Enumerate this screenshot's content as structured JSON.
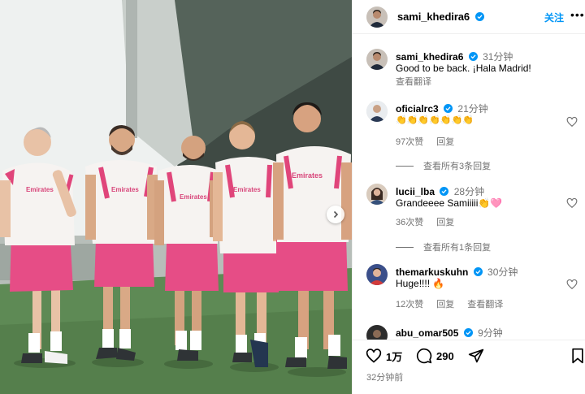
{
  "colors": {
    "accent": "#0095f6",
    "secondary_text": "#737373",
    "jersey_pink": "#e0457a",
    "shorts_pink": "#e64d86",
    "pitch_green": "#5e8a55"
  },
  "photo": {
    "jersey_sponsor": "Emirates"
  },
  "header": {
    "username": "sami_khedira6",
    "follow_label": "关注",
    "more_label": "•••"
  },
  "caption": {
    "username": "sami_khedira6",
    "time": "31分钟",
    "text": "Good to be back. ¡Hala Madrid!",
    "translate_label": "查看翻译"
  },
  "comments": [
    {
      "username": "oficialrc3",
      "time": "21分钟",
      "text": "👏👏👏👏👏👏👏",
      "likes": "97次赞",
      "reply_label": "回复",
      "view_replies": "查看所有3条回复"
    },
    {
      "username": "lucii_lba",
      "time": "28分钟",
      "text": "Grandeeee Samiiiii👏🩷",
      "likes": "36次赞",
      "reply_label": "回复",
      "view_replies": "查看所有1条回复"
    },
    {
      "username": "themarkuskuhn",
      "time": "30分钟",
      "text": "Huge!!!! 🔥",
      "likes": "12次赞",
      "reply_label": "回复",
      "translate_label": "查看翻译"
    },
    {
      "username": "abu_omar505",
      "time": "9分钟"
    }
  ],
  "footer": {
    "likes_count": "1万",
    "comments_count": "290",
    "posted_time": "32分钟前"
  }
}
